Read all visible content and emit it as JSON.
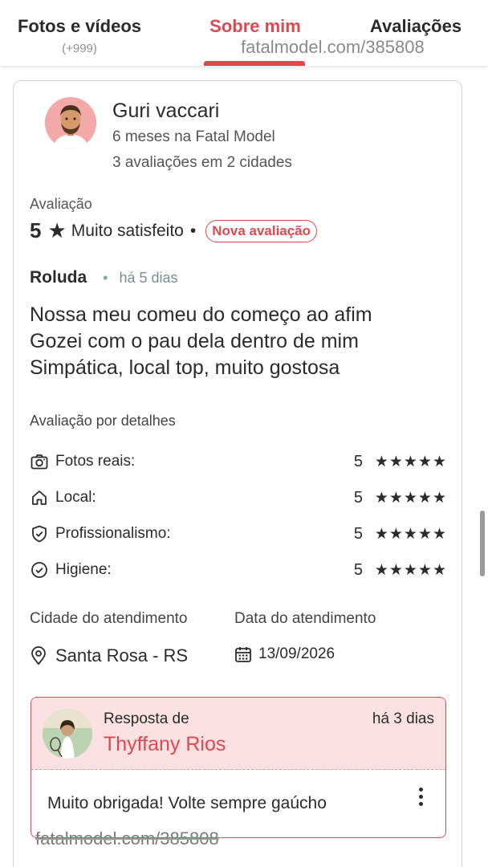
{
  "tabs": {
    "fotos": {
      "label": "Fotos e vídeos",
      "count": "(+999)"
    },
    "sobre": {
      "label": "Sobre mim"
    },
    "avaliacoes": {
      "label": "Avaliações"
    }
  },
  "watermark": {
    "top": "fatalmodel.com/385808",
    "bottom": "fatalmodel.com/385808"
  },
  "review": {
    "reviewer_name": "Guri vaccari",
    "reviewer_since": "6 meses na Fatal Model",
    "reviewer_count": "3 avaliações em 2 cidades",
    "rating_label": "Avaliação",
    "rating_value": "5",
    "rating_text": "Muito satisfeito",
    "rating_dot": "•",
    "badge": "Nova avaliação",
    "escort_name": "Roluda",
    "escort_dot": "•",
    "escort_time": "há 5 dias",
    "body_lines": [
      "Nossa meu comeu do começo ao afim",
      "Gozei com o pau dela dentro de mim",
      "Simpática, local top, muito gostosa"
    ],
    "details_title": "Avaliação por detalhes",
    "details": [
      {
        "label": "Fotos reais:",
        "value": "5",
        "stars": "★★★★★",
        "icon": "camera-icon"
      },
      {
        "label": "Local:",
        "value": "5",
        "stars": "★★★★★",
        "icon": "home-icon"
      },
      {
        "label": "Profissionalismo:",
        "value": "5",
        "stars": "★★★★★",
        "icon": "shield-check-icon"
      },
      {
        "label": "Higiene:",
        "value": "5",
        "stars": "★★★★★",
        "icon": "check-circle-icon"
      }
    ],
    "city_label": "Cidade do atendimento",
    "city_value": "Santa Rosa - RS",
    "date_label": "Data do atendimento",
    "date_value": "13/09/2026"
  },
  "reply": {
    "label": "Resposta de",
    "author": "Thyffany Rios",
    "time": "há 3 dias",
    "text": "Muito obrigada! Volte sempre gaúcho"
  },
  "colors": {
    "accent": "#e0484f",
    "reply_bg": "#fbe1e2",
    "avatar_bg": "#f4a9a9"
  }
}
